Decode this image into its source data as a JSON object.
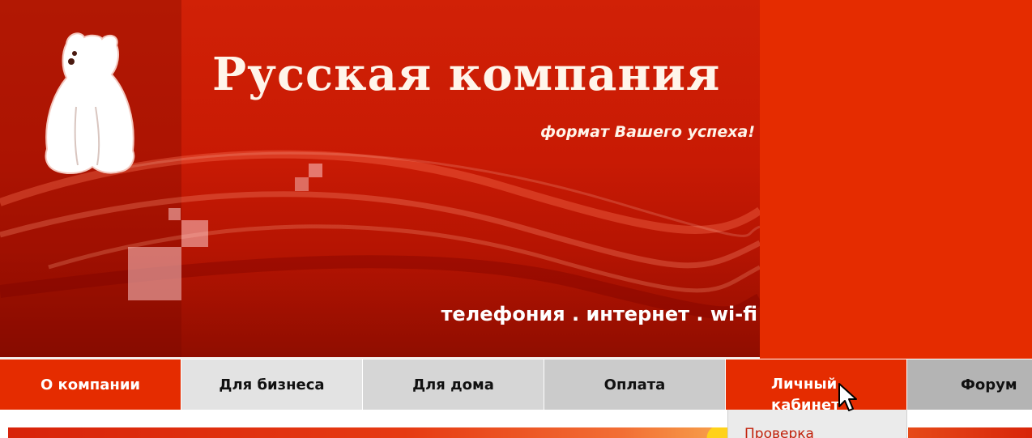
{
  "brand": {
    "title": "Русская компания",
    "slogan": "формат Вашего успеха!",
    "services": "телефония . интернет . wi-fi",
    "logo_icon": "polar-bear-icon",
    "colors": {
      "primary_red": "#e52c00",
      "logo_text": "#fff5ea"
    }
  },
  "nav": {
    "items": [
      {
        "label": "О компании"
      },
      {
        "label": "Для бизнеса"
      },
      {
        "label": "Для дома"
      },
      {
        "label": "Оплата"
      },
      {
        "label": "Личный кабинет"
      },
      {
        "label": "Форум"
      }
    ],
    "dropdown": {
      "item": "Проверка"
    }
  },
  "cursor": {
    "icon": "mouse-pointer-icon"
  }
}
